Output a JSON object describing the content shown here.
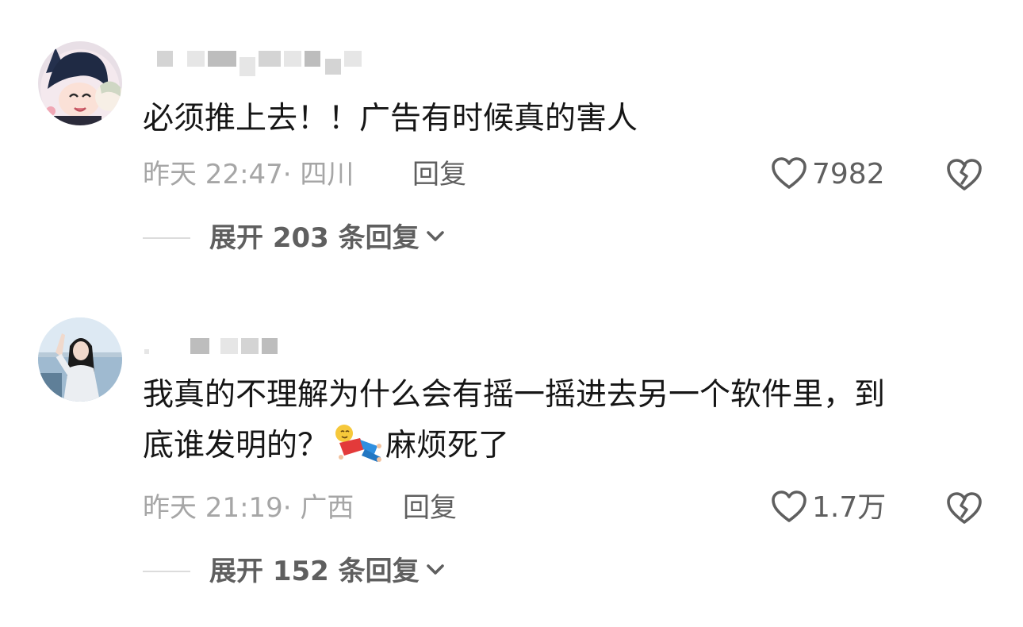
{
  "comments": [
    {
      "text": "必须推上去！！广告有时候真的害人",
      "time": "昨天 22:47",
      "location": "· 四川",
      "reply_label": "回复",
      "like_count": "7982",
      "expand_label": "展开 203 条回复"
    },
    {
      "text_before_sticker": "我真的不理解为什么会有摇一摇进去另一个软件里，到",
      "text_line2_before_sticker": "底谁发明的？",
      "text_after_sticker": "麻烦死了",
      "time": "昨天 21:19",
      "location": "· 广西",
      "reply_label": "回复",
      "like_count": "1.7万",
      "expand_label": "展开 152 条回复"
    }
  ],
  "icons": {
    "like": "heart-outline-icon",
    "dislike": "broken-heart-icon",
    "expand": "chevron-down-icon",
    "sticker": "lying-down-emoji"
  },
  "colors": {
    "text": "#161616",
    "meta": "#a6a6a6",
    "action": "#5f5f5f",
    "rule": "#dcdcdc"
  }
}
